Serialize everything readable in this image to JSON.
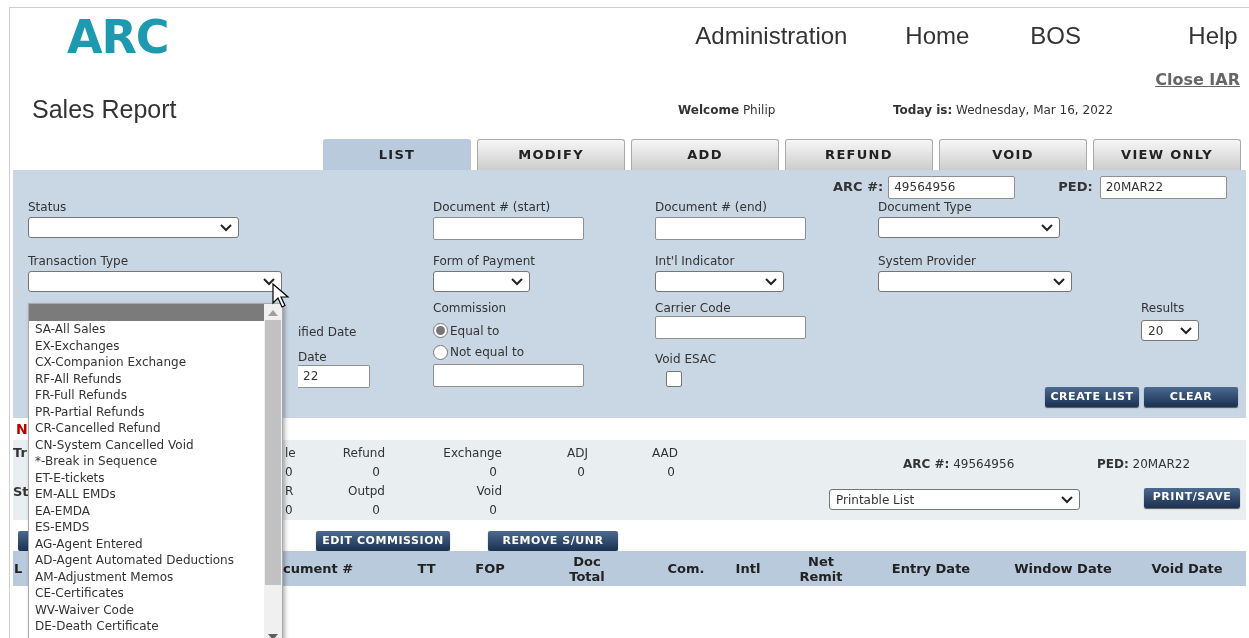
{
  "logo": "ARC",
  "nav": [
    "Administration",
    "Home",
    "BOS",
    "Help"
  ],
  "close_link": "Close IAR",
  "page_title": "Sales Report",
  "welcome": {
    "label": "Welcome",
    "name": "Philip"
  },
  "today": {
    "label": "Today is:",
    "value": "Wednesday, Mar 16, 2022"
  },
  "tabs": [
    {
      "label": "LIST",
      "selected": true
    },
    {
      "label": "MODIFY",
      "selected": false
    },
    {
      "label": "ADD",
      "selected": false
    },
    {
      "label": "REFUND",
      "selected": false
    },
    {
      "label": "VOID",
      "selected": false
    },
    {
      "label": "VIEW ONLY",
      "selected": false
    }
  ],
  "form": {
    "arc": {
      "label": "ARC #:",
      "value": "49564956"
    },
    "ped": {
      "label": "PED:",
      "value": "20MAR22"
    },
    "status": {
      "label": "Status"
    },
    "document_start": {
      "label": "Document # (start)"
    },
    "document_end": {
      "label": "Document # (end)"
    },
    "document_type": {
      "label": "Document Type"
    },
    "transaction_type": {
      "label": "Transaction Type",
      "expanded": true,
      "options": [
        {
          "selected": true
        },
        {
          "label": "SA-All Sales",
          "selected": false
        },
        {
          "label": "EX-Exchanges",
          "selected": false
        },
        {
          "label": "CX-Companion Exchange",
          "selected": false
        },
        {
          "label": "RF-All Refunds",
          "selected": false
        },
        {
          "label": "FR-Full Refunds",
          "selected": false
        },
        {
          "label": "PR-Partial Refunds",
          "selected": false
        },
        {
          "label": "CR-Cancelled Refund",
          "selected": false
        },
        {
          "label": "CN-System Cancelled Void",
          "selected": false
        },
        {
          "label": "*-Break in Sequence",
          "selected": false
        },
        {
          "label": "ET-E-tickets",
          "selected": false
        },
        {
          "label": "EM-ALL EMDs",
          "selected": false
        },
        {
          "label": "EA-EMDA",
          "selected": false
        },
        {
          "label": "ES-EMDS",
          "selected": false
        },
        {
          "label": "AG-Agent Entered",
          "selected": false
        },
        {
          "label": "AD-Agent Automated Deductions",
          "selected": false
        },
        {
          "label": "AM-Adjustment Memos",
          "selected": false
        },
        {
          "label": "CE-Certificates",
          "selected": false
        },
        {
          "label": "WV-Waiver Code",
          "selected": false
        },
        {
          "label": "DE-Death Certificate",
          "selected": false
        }
      ]
    },
    "form_of_payment": {
      "label": "Form of Payment"
    },
    "intl_indicator": {
      "label": "Int'l Indicator"
    },
    "system_provider": {
      "label": "System Provider"
    },
    "date_partial": {
      "label_1": "ified Date",
      "label_2": "Date",
      "value": "22"
    },
    "commission": {
      "label": "Commission",
      "options": [
        {
          "label": "Equal to",
          "selected": true
        },
        {
          "label": "Not equal to",
          "selected": false
        }
      ]
    },
    "carrier_code": {
      "label": "Carrier Code"
    },
    "void_esac": {
      "label": "Void ESAC",
      "checked": false
    },
    "results": {
      "label": "Results",
      "value": "20"
    },
    "buttons": [
      "CREATE LIST",
      "CLEAR"
    ]
  },
  "summary": {
    "heading": "N",
    "row_labels": [
      "Tr",
      "St"
    ],
    "rows": [
      [
        {
          "header": "le",
          "value": "0"
        },
        {
          "header": "Refund",
          "value": "0"
        },
        {
          "header": "Exchange",
          "value": "0"
        },
        {
          "header": "ADJ",
          "value": "0"
        },
        {
          "header": "AAD",
          "value": "0"
        }
      ],
      [
        {
          "header": "R",
          "value": "0"
        },
        {
          "header": "Outpd",
          "value": "0"
        },
        {
          "header": "Void",
          "value": "0"
        }
      ]
    ],
    "arc": {
      "label": "ARC #:",
      "value": "49564956"
    },
    "ped": {
      "label": "PED:",
      "value": "20MAR22"
    },
    "print_format": "Printable List",
    "print_button": "PRINT/SAVE"
  },
  "actions": [
    "EDIT COMMISSION",
    "REMOVE S/UNR"
  ],
  "table": {
    "columns": [
      "L",
      "cument #",
      "TT",
      "FOP",
      "Doc Total",
      "Com.",
      "Intl",
      "Net Remit",
      "Entry Date",
      "Window Date",
      "Void Date"
    ]
  }
}
